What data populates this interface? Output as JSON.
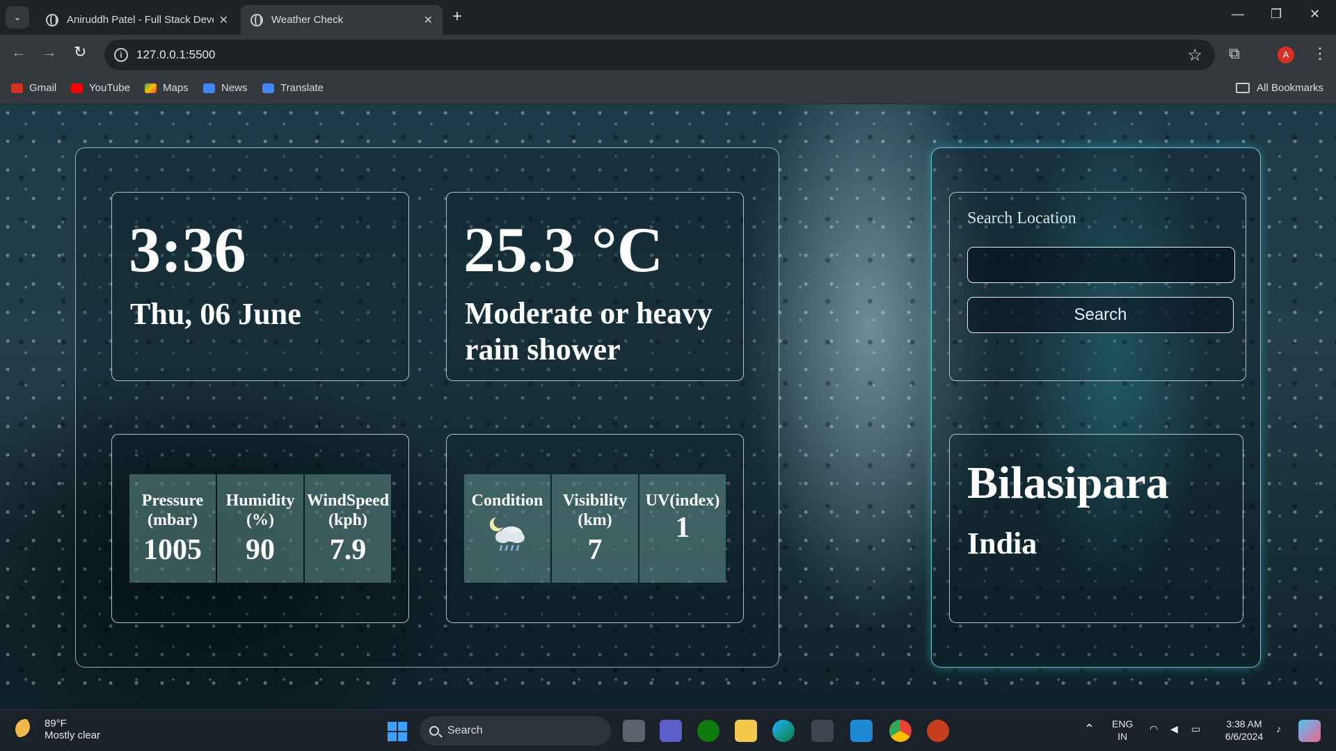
{
  "browser": {
    "tabs": [
      {
        "title": "Aniruddh Patel - Full Stack Deve",
        "active": false
      },
      {
        "title": "Weather Check",
        "active": true
      }
    ],
    "url": "127.0.0.1:5500",
    "bookmarks": [
      "Gmail",
      "YouTube",
      "Maps",
      "News",
      "Translate"
    ],
    "all_bookmarks": "All Bookmarks",
    "profile_initial": "A"
  },
  "weather": {
    "time": "3:36",
    "date": "Thu, 06 June",
    "temperature": "25.3 °C",
    "condition_text": "Moderate or heavy rain shower",
    "stats": [
      {
        "label": "Pressure (mbar)",
        "value": "1005"
      },
      {
        "label": "Humidity (%)",
        "value": "90"
      },
      {
        "label": "WindSpeed (kph)",
        "value": "7.9"
      }
    ],
    "details": {
      "condition_label": "Condition",
      "condition_icon": "moon-cloud-rain-icon",
      "visibility_label": "Visibility (km)",
      "visibility_value": "7",
      "uv_label": "UV(index)",
      "uv_value": "1"
    }
  },
  "search": {
    "label": "Search Location",
    "input_value": "",
    "button_label": "Search"
  },
  "location": {
    "city": "Bilasipara",
    "country": "India"
  },
  "taskbar": {
    "weather_temp": "89°F",
    "weather_desc": "Mostly clear",
    "search_label": "Search",
    "language": "ENG",
    "region": "IN",
    "clock_time": "3:38 AM",
    "clock_date": "6/6/2024"
  },
  "colors": {
    "panel_border": "#c8e1e6",
    "side_glow": "#3cc8dc",
    "cell_bg": "#78aaa5",
    "page_bg": "#1d3a48"
  }
}
